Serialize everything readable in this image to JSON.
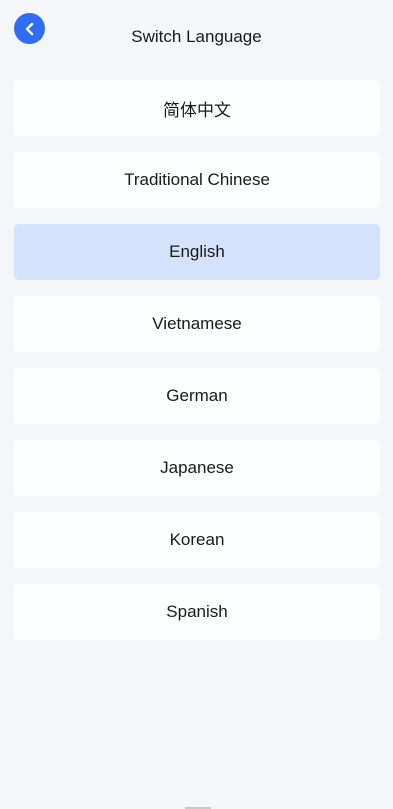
{
  "header": {
    "title": "Switch Language",
    "back_icon": "chevron-left-icon",
    "accent_color": "#2f6ef4"
  },
  "languages": {
    "selected": "English",
    "items": [
      {
        "label": "简体中文"
      },
      {
        "label": "Traditional Chinese"
      },
      {
        "label": "English"
      },
      {
        "label": "Vietnamese"
      },
      {
        "label": "German"
      },
      {
        "label": "Japanese"
      },
      {
        "label": "Korean"
      },
      {
        "label": "Spanish"
      }
    ]
  },
  "colors": {
    "background": "#f4f6f9",
    "item_background": "#fdfefe",
    "selected_background": "#d5e2fc"
  }
}
